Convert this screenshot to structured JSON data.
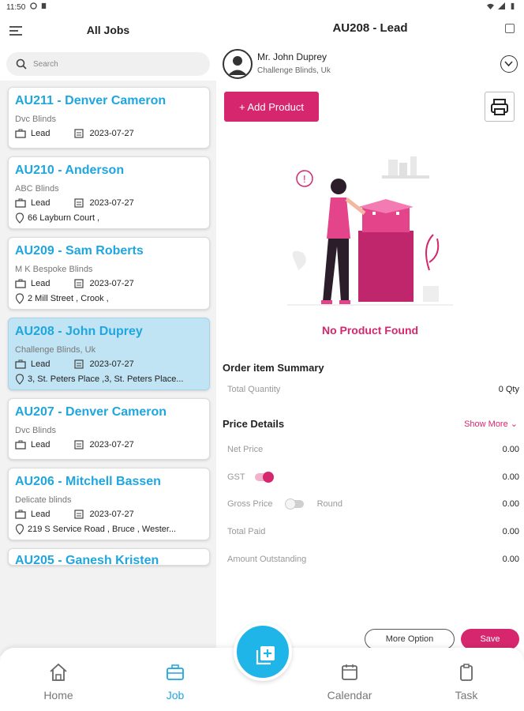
{
  "status_bar": {
    "time": "11:50"
  },
  "left_panel": {
    "title": "All Jobs",
    "search_placeholder": "Search",
    "jobs": [
      {
        "title": "AU211 - Denver Cameron",
        "company": "Dvc Blinds",
        "status": "Lead",
        "date": "2023-07-27",
        "address": ""
      },
      {
        "title": "AU210 - Anderson",
        "company": "ABC Blinds",
        "status": "Lead",
        "date": "2023-07-27",
        "address": "66 Layburn Court ,"
      },
      {
        "title": "AU209 - Sam Roberts",
        "company": "M K Bespoke Blinds",
        "status": "Lead",
        "date": "2023-07-27",
        "address": "2 Mill Street ,  Crook ,"
      },
      {
        "title": "AU208 - John Duprey",
        "company": "Challenge Blinds, Uk",
        "status": "Lead",
        "date": "2023-07-27",
        "address": "3, St. Peters Place ,3, St. Peters Place..."
      },
      {
        "title": "AU207 - Denver Cameron",
        "company": "Dvc Blinds",
        "status": "Lead",
        "date": "2023-07-27",
        "address": ""
      },
      {
        "title": "AU206 - Mitchell Bassen",
        "company": "Delicate blinds",
        "status": "Lead",
        "date": "2023-07-27",
        "address": "219 S Service Road ,  Bruce , Wester..."
      },
      {
        "title": "AU205 - Ganesh Kristen"
      }
    ]
  },
  "right_panel": {
    "title": "AU208 - Lead",
    "customer_name": "Mr. John Duprey",
    "customer_company": "Challenge Blinds, Uk",
    "add_product_label": "+ Add Product",
    "empty_message": "No Product Found",
    "order_summary_heading": "Order item Summary",
    "total_quantity_label": "Total Quantity",
    "total_quantity_value": "0 Qty",
    "price_details_heading": "Price Details",
    "show_more_label": "Show More ⌄",
    "net_price_label": "Net Price",
    "net_price_value": "0.00",
    "gst_label": "GST",
    "gst_value": "0.00",
    "gst_enabled": true,
    "gross_price_label": "Gross Price",
    "round_label": "Round",
    "round_enabled": false,
    "gross_price_value": "0.00",
    "total_paid_label": "Total Paid",
    "total_paid_value": "0.00",
    "amount_outstanding_label": "Amount Outstanding",
    "amount_outstanding_value": "0.00",
    "more_option_label": "More Option",
    "save_label": "Save"
  },
  "bottom_nav": {
    "home_label": "Home",
    "job_label": "Job",
    "calendar_label": "Calendar",
    "task_label": "Task",
    "active": "Job"
  },
  "colors": {
    "accent_pink": "#d6276e",
    "accent_blue": "#1fa6df",
    "selected_card": "#c1e4f5"
  }
}
